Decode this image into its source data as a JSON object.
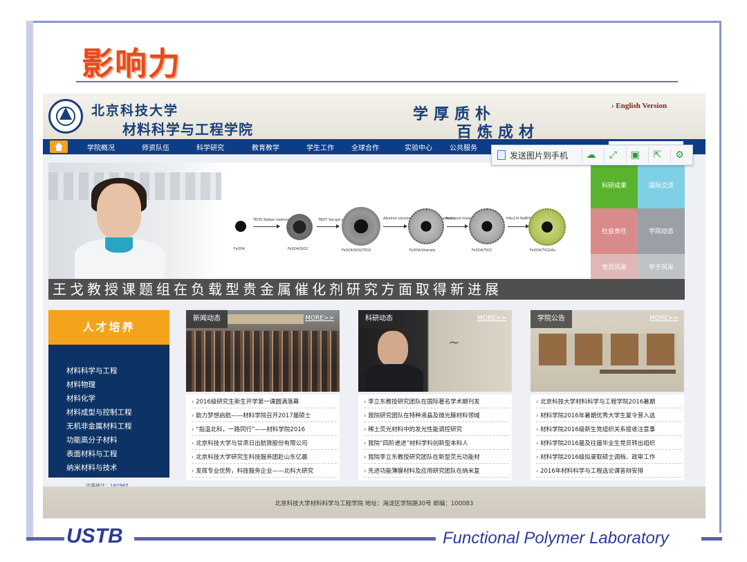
{
  "slide": {
    "title": "影响力",
    "footer_left": "USTB",
    "footer_right": "Functional Polymer Laboratory"
  },
  "site": {
    "university": "北京科技大学",
    "school": "材料科学与工程学院",
    "motto_line1": "学厚质朴",
    "motto_line2": "百炼成材",
    "english_link": "English Version",
    "nav": [
      "学院概况",
      "师资队伍",
      "科学研究",
      "教育教学",
      "学生工作",
      "全球合作",
      "实验中心",
      "公共服务"
    ],
    "toolbar": {
      "send_label": "发送图片到手机",
      "icons": [
        "cloud-icon",
        "fullscreen-icon",
        "save-icon",
        "share-icon",
        "settings-icon"
      ]
    },
    "banner": {
      "caption": "王戈教授课题组在负载型贵金属催化剂研究方面取得新进展",
      "schematic_labels": [
        "Fe3O4",
        "TEOS Stöber method",
        "Fe3O4/SiO2",
        "TBOT Sol-gel process",
        "Fe3O4/SiO2/TiO2",
        "Alkaline solution Hydrothermal treatment",
        "Fe3O4/titanate",
        "Acid post-treatment Calcination",
        "Fe3O4/TiO2",
        "HAuCl4 NaBH4 reduction",
        "Fe3O4/TiO2/Au"
      ],
      "tiles": [
        {
          "label": "科研成果",
          "color": "#5ab32e"
        },
        {
          "label": "国际交流",
          "color": "#7fd0e6"
        },
        {
          "label": "社会责任",
          "color": "#d98a8a"
        },
        {
          "label": "学院动态",
          "color": "#9aa0a6"
        },
        {
          "label": "党员风采",
          "color": "#e0b7b7"
        },
        {
          "label": "学子风采",
          "color": "#bfc3c7"
        }
      ]
    },
    "talent": {
      "heading": "人才培养",
      "items": [
        "材料科学与工程",
        "材料物理",
        "材料化学",
        "材料成型与控制工程",
        "无机非金属材料工程",
        "功能高分子材料",
        "表面材料与工程",
        "纳米材料与技术"
      ],
      "visits_label": "访客统计：",
      "visits_count": "182987"
    },
    "columns": [
      {
        "label": "新闻动态",
        "more": "MORE>>",
        "items": [
          "2016级研究生新生开学第一课圆满落幕",
          "助力梦想启航——材料学院召开2017届硕士",
          "“指温北科，一路同行”——材料学院2016",
          "北京科技大学与甘肃日出航铁股份有限公司",
          "北京科技大学研究生科技服务团赴山东亿晨",
          "发挥专业优势，科技服务企业——北科大研究"
        ]
      },
      {
        "label": "科研动态",
        "more": "MORE>>",
        "items": [
          "李立东教授研究团队在国际著名学术期刊发",
          "我院研究团队在特种液晶及微光膜材料领域",
          "稀土荧光材料中的发光性能调控研究",
          "我院“四阶递进”材料学科创新型本科人",
          "我院李立东教授研究团队在新型荧光功能材",
          "先进功能薄膜材料及应用研究团队在纳米复"
        ]
      },
      {
        "label": "学院公告",
        "more": "MORE>>",
        "items": [
          "北京科技大学材料科学与工程学院2016暑期",
          "材料学院2016年暑期优秀大学生夏令营入选",
          "材料学院2016级新生党组织关系接收注意事",
          "材料学院2016届及往届毕业生党员转出组织",
          "材料学院2016级拟录取硕士调档、政审工作",
          "2016年材料科学与工程选论课答辩安排"
        ]
      }
    ],
    "footer": "北京科技大学材料科学与工程学院    地址：海淀区学院路30号    邮编：100083"
  }
}
